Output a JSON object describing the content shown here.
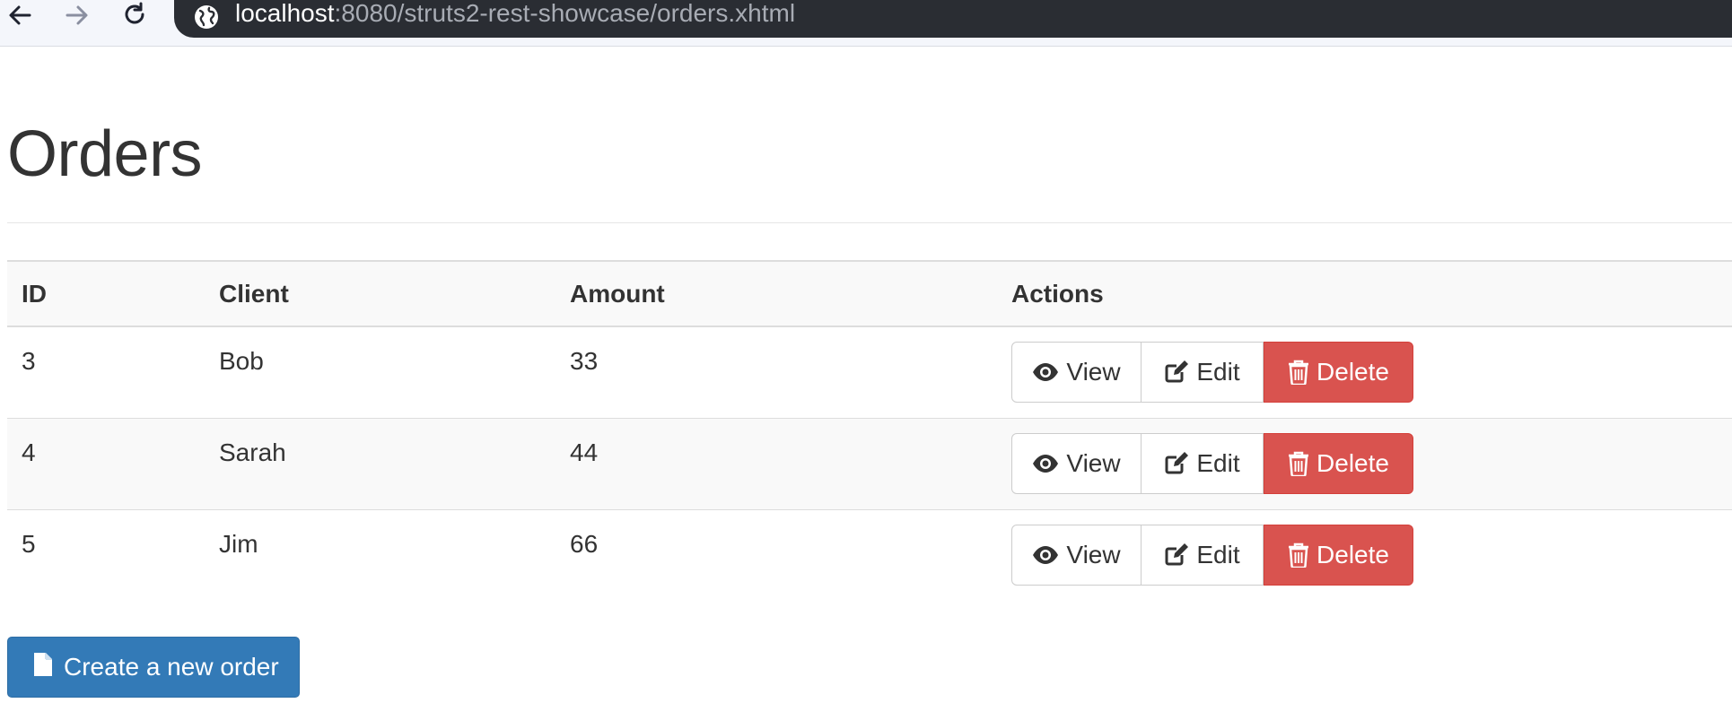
{
  "browser": {
    "url_host": "localhost",
    "url_rest": ":8080/struts2-rest-showcase/orders.xhtml",
    "icons": [
      "back-icon",
      "forward-icon",
      "reload-icon",
      "site-info-icon"
    ]
  },
  "page": {
    "title": "Orders"
  },
  "table": {
    "headers": {
      "id": "ID",
      "client": "Client",
      "amount": "Amount",
      "actions": "Actions"
    },
    "rows": [
      {
        "id": "3",
        "client": "Bob",
        "amount": "33"
      },
      {
        "id": "4",
        "client": "Sarah",
        "amount": "44"
      },
      {
        "id": "5",
        "client": "Jim",
        "amount": "66"
      }
    ],
    "actions": {
      "view_label": "View",
      "edit_label": "Edit",
      "delete_label": "Delete"
    }
  },
  "create_button": {
    "label": "Create a new order"
  },
  "colors": {
    "danger": "#d9534f",
    "primary": "#337ab7",
    "address_bar": "#2a2d33"
  }
}
